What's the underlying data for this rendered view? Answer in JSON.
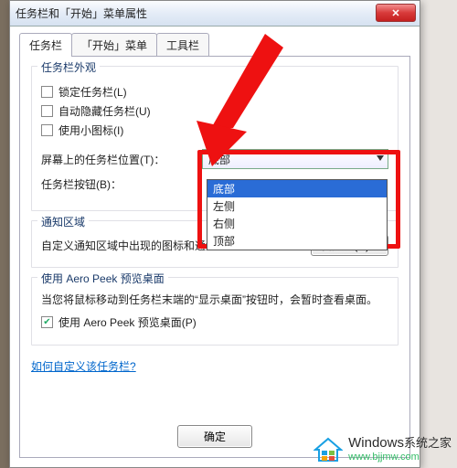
{
  "window": {
    "title": "任务栏和「开始」菜单属性",
    "close_label": "✕"
  },
  "tabs": {
    "taskbar": "任务栏",
    "start": "「开始」菜单",
    "toolbar": "工具栏"
  },
  "appearance": {
    "legend": "任务栏外观",
    "lock": "锁定任务栏(L)",
    "autohide": "自动隐藏任务栏(U)",
    "smallicons": "使用小图标(I)",
    "position_label": "屏幕上的任务栏位置(T)：",
    "position_value": "底部",
    "position_options": {
      "bottom": "底部",
      "left": "左侧",
      "right": "右侧",
      "top": "顶部"
    },
    "buttons_label": "任务栏按钮(B)："
  },
  "notify": {
    "legend": "通知区域",
    "desc": "自定义通知区域中出现的图标和通知。",
    "customize_btn": "自定义(C)..."
  },
  "aero": {
    "legend": "使用 Aero Peek 预览桌面",
    "desc": "当您将鼠标移动到任务栏末端的“显示桌面”按钮时，会暂时查看桌面。",
    "checkbox": "使用 Aero Peek 预览桌面(P)"
  },
  "help_link": "如何自定义该任务栏?",
  "buttons": {
    "ok": "确定"
  },
  "watermark": {
    "brand": "Windows",
    "sub1": "系统之家",
    "sub2": "www.bjjmw.com"
  }
}
